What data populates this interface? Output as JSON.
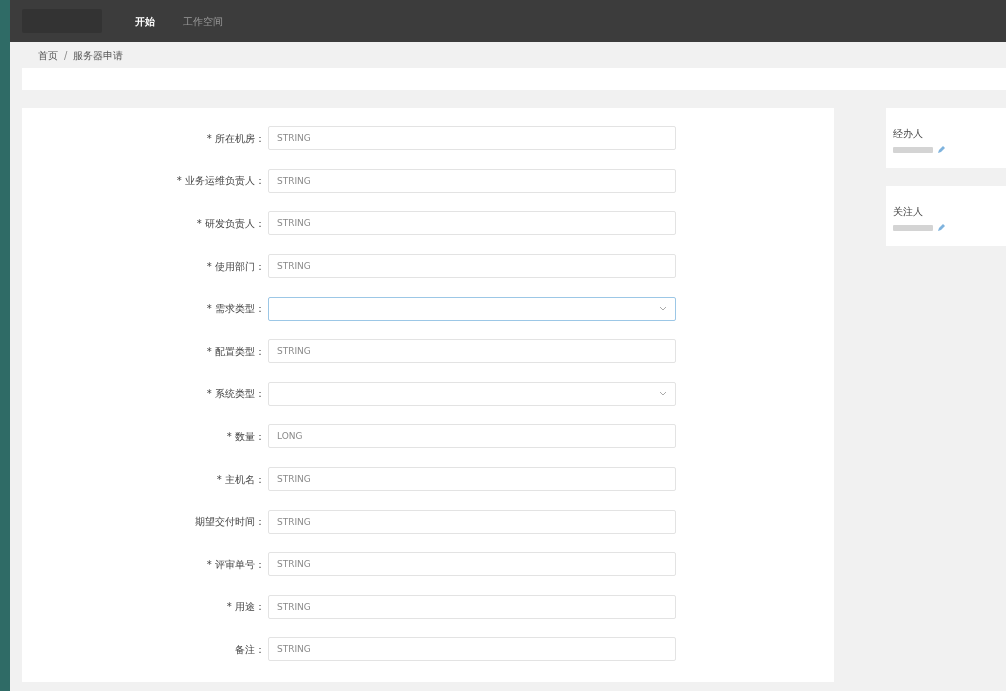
{
  "nav": {
    "items": [
      {
        "label": "开始",
        "selected": true
      },
      {
        "label": "工作空间",
        "selected": false
      }
    ]
  },
  "breadcrumb": {
    "items": [
      "首页",
      "服务器申请"
    ],
    "separator": "/"
  },
  "form": {
    "fields": [
      {
        "label": "* 所在机房：",
        "kind": "text",
        "placeholder": "STRING"
      },
      {
        "label": "* 业务运维负责人：",
        "kind": "text",
        "placeholder": "STRING"
      },
      {
        "label": "* 研发负责人：",
        "kind": "text",
        "placeholder": "STRING"
      },
      {
        "label": "* 使用部门：",
        "kind": "text",
        "placeholder": "STRING"
      },
      {
        "label": "* 需求类型：",
        "kind": "select",
        "focused": true
      },
      {
        "label": "* 配置类型：",
        "kind": "text",
        "placeholder": "STRING"
      },
      {
        "label": "* 系统类型：",
        "kind": "select",
        "focused": false
      },
      {
        "label": "* 数量：",
        "kind": "text",
        "placeholder": "LONG"
      },
      {
        "label": "* 主机名：",
        "kind": "text",
        "placeholder": "STRING"
      },
      {
        "label": "期望交付时间：",
        "kind": "text",
        "placeholder": "STRING"
      },
      {
        "label": "* 评审单号：",
        "kind": "text",
        "placeholder": "STRING"
      },
      {
        "label": "* 用途：",
        "kind": "text",
        "placeholder": "STRING"
      },
      {
        "label": "备注：",
        "kind": "text",
        "placeholder": "STRING"
      }
    ]
  },
  "side_cards": [
    {
      "title": "经办人"
    },
    {
      "title": "关注人"
    }
  ]
}
